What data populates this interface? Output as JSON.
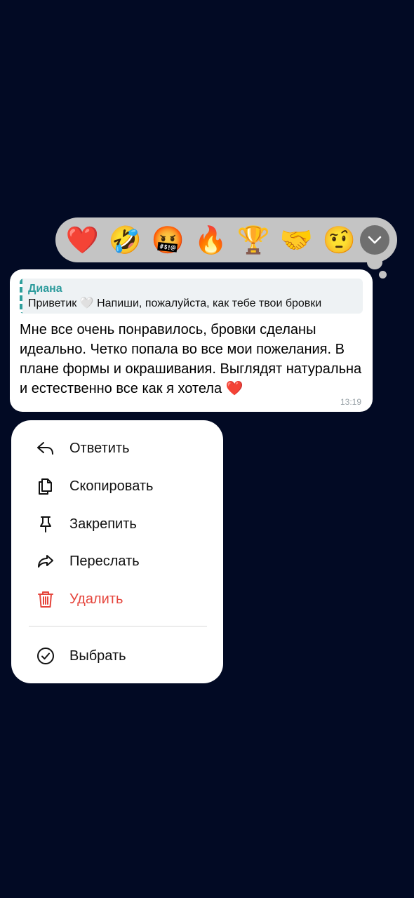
{
  "reactions": [
    {
      "name": "heart",
      "glyph": "❤️"
    },
    {
      "name": "rofl",
      "glyph": "🤣"
    },
    {
      "name": "cursing-face",
      "glyph": "🤬"
    },
    {
      "name": "fire",
      "glyph": "🔥"
    },
    {
      "name": "trophy",
      "glyph": "🏆"
    },
    {
      "name": "handshake",
      "glyph": "🤝"
    },
    {
      "name": "raised-eyebrow",
      "glyph": "🤨"
    }
  ],
  "expand_icon": "chevron-down-icon",
  "message": {
    "reply": {
      "author": "Диана",
      "text": "Приветик 🤍 Напиши, пожалуйста, как тебе твои бровки"
    },
    "text": "Мне все очень понравилось, бровки сделаны идеально. Четко попала во все мои пожелания. В плане формы и окрашивания. Выглядят натуральна и естественно все как я хотела ❤️",
    "time": "13:19"
  },
  "menu": {
    "items": [
      {
        "id": "reply",
        "label": "Ответить",
        "icon": "reply-icon"
      },
      {
        "id": "copy",
        "label": "Скопировать",
        "icon": "copy-icon"
      },
      {
        "id": "pin",
        "label": "Закрепить",
        "icon": "pin-icon"
      },
      {
        "id": "forward",
        "label": "Переслать",
        "icon": "forward-icon"
      },
      {
        "id": "delete",
        "label": "Удалить",
        "icon": "trash-icon"
      },
      {
        "id": "select",
        "label": "Выбрать",
        "icon": "check-circle-icon"
      }
    ]
  },
  "colors": {
    "background": "#020a24",
    "reaction_bar": "#c4c4c4",
    "reply_author": "#2c9b9c",
    "danger": "#e5453c"
  }
}
